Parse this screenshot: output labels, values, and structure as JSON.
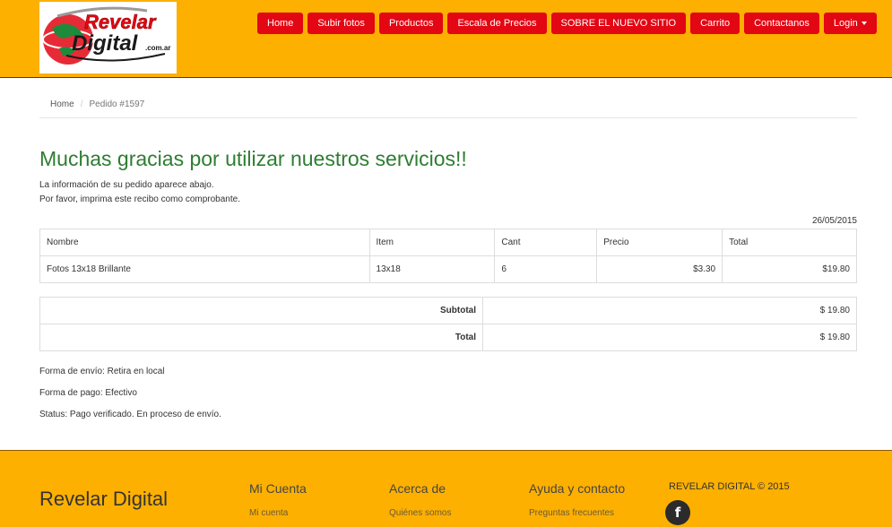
{
  "header": {
    "logo_line1": "Revelar",
    "logo_line2": "Digital",
    "logo_suffix": ".com.ar",
    "nav": [
      "Home",
      "Subir fotos",
      "Productos",
      "Escala de Precios",
      "SOBRE EL NUEVO SITIO",
      "Carrito",
      "Contactanos"
    ],
    "login_label": "Login"
  },
  "breadcrumb": {
    "home": "Home",
    "current": "Pedido #1597"
  },
  "main": {
    "title": "Muchas gracias por utilizar nuestros servicios!!",
    "info_line1": "La información de su pedido aparece abajo.",
    "info_line2": "Por favor, imprima este recibo como comprobante.",
    "date": "26/05/2015"
  },
  "items_table": {
    "headers": [
      "Nombre",
      "Item",
      "Cant",
      "Precio",
      "Total"
    ],
    "rows": [
      [
        "Fotos 13x18 Brillante",
        "13x18",
        "6",
        "$3.30",
        "$19.80"
      ]
    ]
  },
  "totals": {
    "subtotal_label": "Subtotal",
    "subtotal_value": "$ 19.80",
    "total_label": "Total",
    "total_value": "$ 19.80"
  },
  "order_meta": {
    "shipping": "Forma de envío: Retira en local",
    "payment": "Forma de pago: Efectivo",
    "status": "Status: Pago verificado. En proceso de envío."
  },
  "footer": {
    "brand": "Revelar Digital",
    "col1_title": "Mi Cuenta",
    "col1_link": "Mi cuenta",
    "col2_title": "Acerca de",
    "col2_link": "Quiénes somos",
    "col3_title": "Ayuda y contacto",
    "col3_link": "Preguntas frecuentes",
    "copyright": "REVELAR DIGITAL © 2015",
    "facebook_glyph": "f"
  },
  "colors": {
    "header_bg": "#fdb000",
    "nav_button": "#e30613",
    "title_green": "#2e7d32"
  }
}
